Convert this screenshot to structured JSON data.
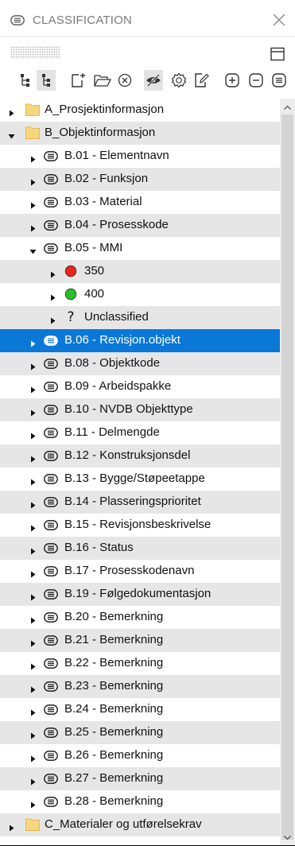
{
  "panel": {
    "title": "CLASSIFICATION"
  },
  "toolbar": {
    "buttons": [
      {
        "icon": "hierarchy-tree-icon"
      },
      {
        "icon": "indented-tree-icon",
        "active": true
      },
      {
        "icon": "new-document-icon"
      },
      {
        "icon": "open-folder-icon"
      },
      {
        "icon": "remove-circle-icon"
      },
      {
        "icon": "visibility-off-icon",
        "active": true
      },
      {
        "icon": "settings-gear-icon"
      },
      {
        "icon": "edit-document-icon"
      },
      {
        "icon": "expand-all-icon"
      },
      {
        "icon": "collapse-all-icon"
      },
      {
        "icon": "show-all-icon"
      }
    ]
  },
  "tree": {
    "rows": [
      {
        "label": "A_Prosjektinformasjon",
        "level": 0,
        "icon": "folder",
        "state": "collapsed"
      },
      {
        "label": "B_Objektinformasjon",
        "level": 0,
        "icon": "folder",
        "state": "expanded"
      },
      {
        "label": "B.01 - Elementnavn",
        "level": 1,
        "icon": "tag",
        "state": "collapsed"
      },
      {
        "label": "B.02 - Funksjon",
        "level": 1,
        "icon": "tag",
        "state": "collapsed"
      },
      {
        "label": "B.03 - Material",
        "level": 1,
        "icon": "tag",
        "state": "collapsed"
      },
      {
        "label": "B.04 - Prosesskode",
        "level": 1,
        "icon": "tag",
        "state": "collapsed"
      },
      {
        "label": "B.05 - MMI",
        "level": 1,
        "icon": "tag",
        "state": "expanded"
      },
      {
        "label": "350",
        "level": 2,
        "icon": "red-dot",
        "state": "collapsed"
      },
      {
        "label": "400",
        "level": 2,
        "icon": "green-dot",
        "state": "collapsed"
      },
      {
        "label": "Unclassified",
        "level": 2,
        "icon": "question",
        "state": "collapsed"
      },
      {
        "label": "B.06 - Revisjon.objekt",
        "level": 1,
        "icon": "tag",
        "state": "collapsed",
        "selected": true
      },
      {
        "label": "B.08 - Objektkode",
        "level": 1,
        "icon": "tag",
        "state": "collapsed"
      },
      {
        "label": "B.09 - Arbeidspakke",
        "level": 1,
        "icon": "tag",
        "state": "collapsed"
      },
      {
        "label": "B.10 - NVDB Objekttype",
        "level": 1,
        "icon": "tag",
        "state": "collapsed"
      },
      {
        "label": "B.11 - Delmengde",
        "level": 1,
        "icon": "tag",
        "state": "collapsed"
      },
      {
        "label": "B.12 - Konstruksjonsdel",
        "level": 1,
        "icon": "tag",
        "state": "collapsed"
      },
      {
        "label": "B.13 - Bygge/Støpeetappe",
        "level": 1,
        "icon": "tag",
        "state": "collapsed"
      },
      {
        "label": "B.14 - Plasseringsprioritet",
        "level": 1,
        "icon": "tag",
        "state": "collapsed"
      },
      {
        "label": "B.15 - Revisjonsbeskrivelse",
        "level": 1,
        "icon": "tag",
        "state": "collapsed"
      },
      {
        "label": "B.16 - Status",
        "level": 1,
        "icon": "tag",
        "state": "collapsed"
      },
      {
        "label": "B.17 - Prosesskodenavn",
        "level": 1,
        "icon": "tag",
        "state": "collapsed"
      },
      {
        "label": "B.19 - Følgedokumentasjon",
        "level": 1,
        "icon": "tag",
        "state": "collapsed"
      },
      {
        "label": "B.20 - Bemerkning",
        "level": 1,
        "icon": "tag",
        "state": "collapsed"
      },
      {
        "label": "B.21 - Bemerkning",
        "level": 1,
        "icon": "tag",
        "state": "collapsed"
      },
      {
        "label": "B.22 - Bemerkning",
        "level": 1,
        "icon": "tag",
        "state": "collapsed"
      },
      {
        "label": "B.23 - Bemerkning",
        "level": 1,
        "icon": "tag",
        "state": "collapsed"
      },
      {
        "label": "B.24 - Bemerkning",
        "level": 1,
        "icon": "tag",
        "state": "collapsed"
      },
      {
        "label": "B.25 - Bemerkning",
        "level": 1,
        "icon": "tag",
        "state": "collapsed"
      },
      {
        "label": "B.26 - Bemerkning",
        "level": 1,
        "icon": "tag",
        "state": "collapsed"
      },
      {
        "label": "B.27 - Bemerkning",
        "level": 1,
        "icon": "tag",
        "state": "collapsed"
      },
      {
        "label": "B.28 - Bemerkning",
        "level": 1,
        "icon": "tag",
        "state": "collapsed"
      },
      {
        "label": "C_Materialer og utførelsekrav",
        "level": 0,
        "icon": "folder",
        "state": "collapsed"
      }
    ]
  },
  "colors": {
    "selection": "#0a78d7",
    "alt_row": "#e6e6e6",
    "folder": "#f7d77e",
    "dot_red": "#e8241c",
    "dot_green": "#27c227"
  }
}
